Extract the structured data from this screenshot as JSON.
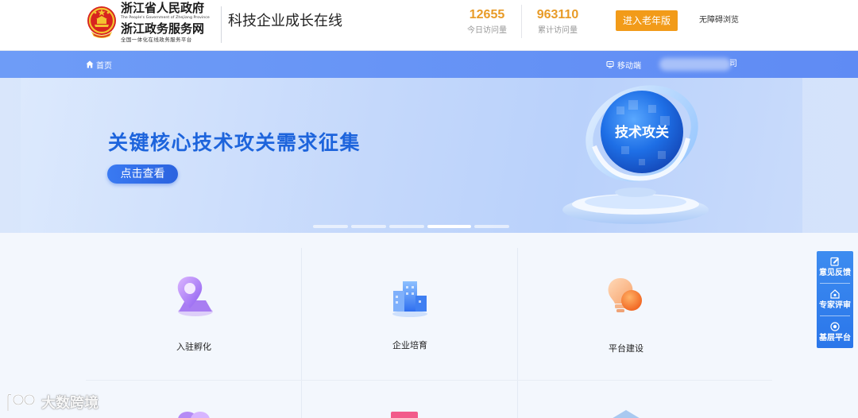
{
  "header": {
    "gov_name": "浙江省人民政府",
    "gov_en": "The People's Government of Zhejiang Province",
    "service_name": "浙江政务服务网",
    "service_sub": "全国一体化在线政务服务平台",
    "site_title": "科技企业成长在线",
    "stats": [
      {
        "value": "12655",
        "label": "今日访问量"
      },
      {
        "value": "963110",
        "label": "累计访问量"
      }
    ],
    "elder_button": "进入老年版",
    "accessibility_link": "无障碍浏览"
  },
  "nav": {
    "home": "首页",
    "mobile": "移动端",
    "tail": "司"
  },
  "banner": {
    "title": "关键核心技术攻关需求征集",
    "button": "点击查看",
    "globe_label": "技术攻关",
    "slide_count": 5,
    "active_slide": 4
  },
  "tiles": [
    {
      "label": "入驻孵化",
      "icon": "location-pin-icon"
    },
    {
      "label": "企业培育",
      "icon": "buildings-icon"
    },
    {
      "label": "平台建设",
      "icon": "lightbulb-icon"
    }
  ],
  "float_panel": [
    {
      "label": "意见反馈",
      "icon": "feedback-edit-icon"
    },
    {
      "label": "专家评审",
      "icon": "expert-home-icon"
    },
    {
      "label": "基层平台",
      "icon": "platform-circle-icon"
    }
  ],
  "watermark": "大数跨境",
  "colors": {
    "accent_orange": "#f29b19",
    "stat_orange": "#e89b27",
    "nav_blue": "#6e9cf7",
    "banner_title_blue": "#1d64dc",
    "float_blue": "#2a76ea"
  }
}
